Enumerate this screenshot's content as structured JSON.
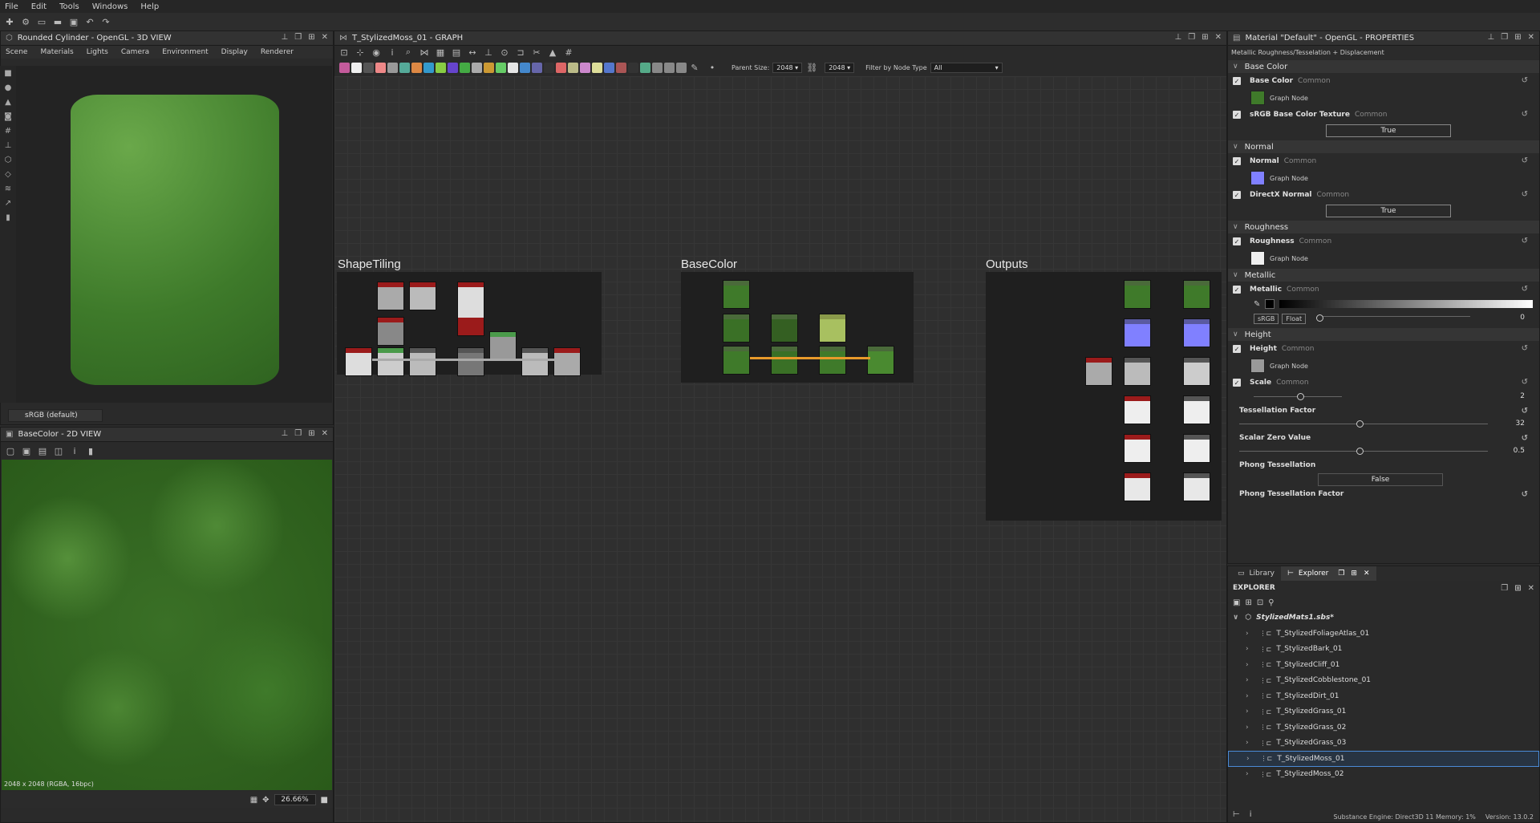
{
  "menu": [
    "File",
    "Edit",
    "Tools",
    "Windows",
    "Help"
  ],
  "view3d": {
    "title": "Rounded Cylinder - OpenGL - 3D VIEW",
    "submenu": [
      "Scene",
      "Materials",
      "Lights",
      "Camera",
      "Environment",
      "Display",
      "Renderer"
    ],
    "colorspace": "sRGB (default)"
  },
  "view2d": {
    "title": "BaseColor - 2D VIEW",
    "resolution": "2048 x 2048 (RGBA, 16bpc)",
    "zoom": "26.66%"
  },
  "graph": {
    "title": "T_StylizedMoss_01 - GRAPH",
    "parent_size_label": "Parent Size:",
    "parent_size": "2048",
    "size2": "2048",
    "filter_label": "Filter by Node Type",
    "filter_value": "All",
    "frames": [
      "ShapeTiling",
      "BaseColor",
      "Outputs"
    ]
  },
  "properties": {
    "title": "Material \"Default\" - OpenGL - PROPERTIES",
    "subtitle": "Metallic Roughness/Tesselation + Displacement",
    "sections": {
      "base_color": "Base Color",
      "normal": "Normal",
      "roughness": "Roughness",
      "metallic": "Metallic",
      "height": "Height"
    },
    "common": "Common",
    "graph_node": "Graph Node",
    "base_color": "Base Color",
    "srgb_texture": "sRGB Base Color Texture",
    "srgb_value": "True",
    "normal": "Normal",
    "directx_normal": "DirectX Normal",
    "directx_value": "True",
    "roughness": "Roughness",
    "metallic": "Metallic",
    "srgb_btn": "sRGB",
    "float_btn": "Float",
    "metallic_value": "0",
    "height": "Height",
    "scale": "Scale",
    "scale_value": "2",
    "tess_factor": "Tessellation Factor",
    "tess_value": "32",
    "scalar_zero": "Scalar Zero Value",
    "scalar_value": "0.5",
    "phong_tess": "Phong Tessellation",
    "phong_value": "False",
    "phong_factor": "Phong Tessellation Factor"
  },
  "explorer": {
    "tabs": [
      "Library",
      "Explorer"
    ],
    "title": "EXPLORER",
    "package": "StylizedMats1.sbs*",
    "items": [
      "T_StylizedFoliageAtlas_01",
      "T_StylizedBark_01",
      "T_StylizedCliff_01",
      "T_StylizedCobblestone_01",
      "T_StylizedDirt_01",
      "T_StylizedGrass_01",
      "T_StylizedGrass_02",
      "T_StylizedGrass_03",
      "T_StylizedMoss_01",
      "T_StylizedMoss_02"
    ],
    "selected_index": 8
  },
  "status": {
    "engine": "Substance Engine: Direct3D 11  Memory: 1%",
    "version": "Version: 13.0.2"
  },
  "colors": {
    "accent": "#4a8ad6",
    "wire": "#e89a2a",
    "node_red": "#9b1b1b",
    "node_green": "#3f7a2a"
  }
}
